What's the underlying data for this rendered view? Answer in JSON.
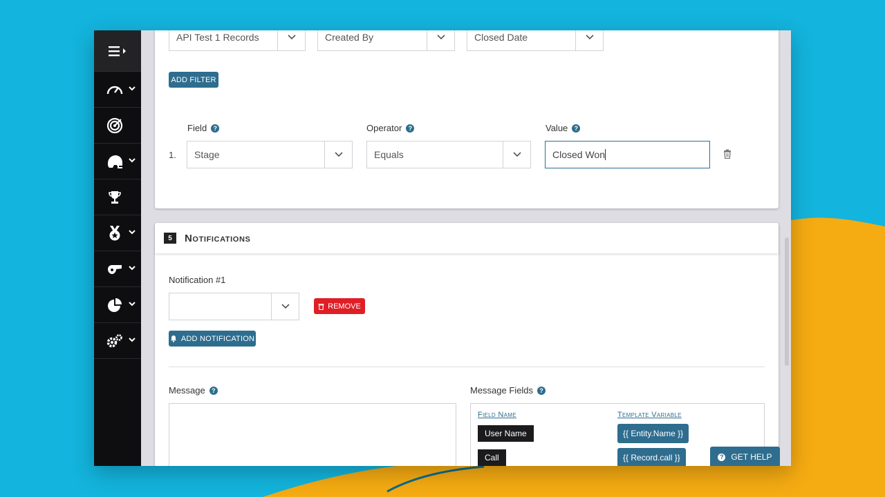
{
  "filters": {
    "dropdowns": [
      "API Test 1 Records",
      "Created By",
      "Closed Date"
    ],
    "add_filter_label": "ADD FILTER"
  },
  "condition": {
    "field_label": "Field",
    "operator_label": "Operator",
    "value_label": "Value",
    "row_number": "1.",
    "field_value": "Stage",
    "operator_value": "Equals",
    "value_value": "Closed Won"
  },
  "notifications": {
    "section_number": "5",
    "section_title": "Notifications",
    "notification_label": "Notification #1",
    "notification_select_value": "",
    "remove_label": "REMOVE",
    "add_notification_label": "ADD NOTIFICATION",
    "message_label": "Message",
    "message_fields_label": "Message Fields",
    "field_name_header": "Field Name",
    "template_variable_header": "Template Variable",
    "rows": [
      {
        "field": "User Name",
        "variable": "{{ Entity.Name }}"
      },
      {
        "field": "Call",
        "variable": "{{ Record.call }}"
      }
    ]
  },
  "get_help_label": "GET HELP",
  "sidebar_icons": [
    "menu-icon",
    "dashboard-icon",
    "target-icon",
    "helmet-icon",
    "trophy-icon",
    "medal-icon",
    "whistle-icon",
    "pie-chart-icon",
    "gears-icon"
  ],
  "colors": {
    "primary": "#2e6d8e",
    "danger": "#e01e25",
    "sidebar": "#0e0e10",
    "background_blue": "#13b4dd",
    "background_orange": "#f5ab12"
  }
}
